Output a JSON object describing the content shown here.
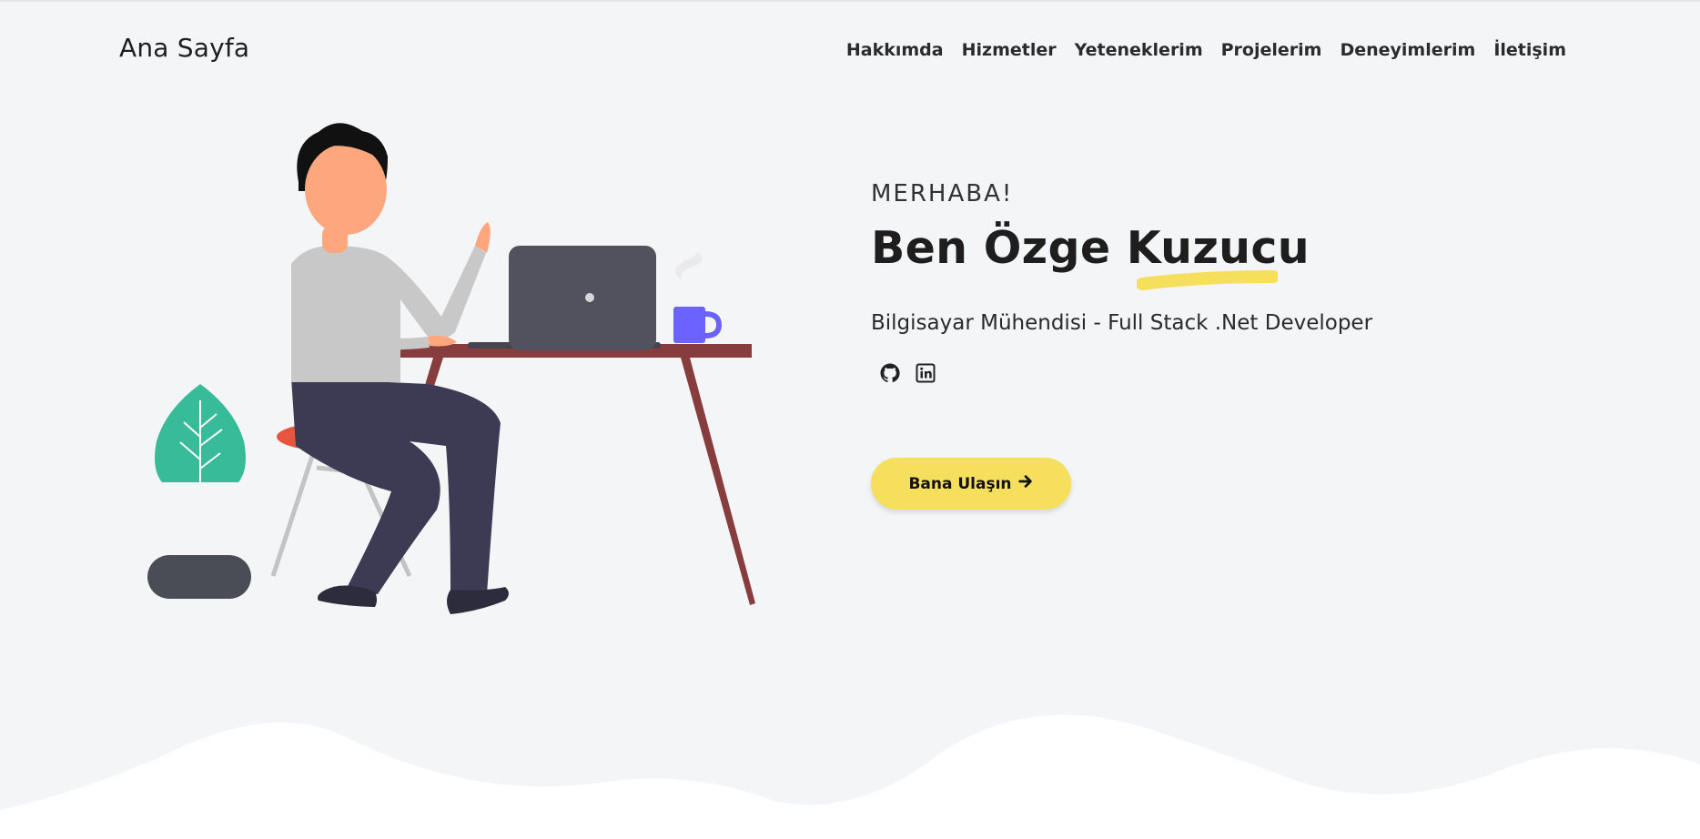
{
  "header": {
    "brand": "Ana Sayfa",
    "nav": [
      "Hakkımda",
      "Hizmetler",
      "Yeteneklerim",
      "Projelerim",
      "Deneyimlerim",
      "İletişim"
    ]
  },
  "hero": {
    "greeting": "MERHABA!",
    "name": "Ben Özge Kuzucu",
    "subtitle": "Bilgisayar Mühendisi - Full Stack .Net Developer",
    "cta_label": "Bana Ulaşın",
    "cta_icon": "arrow-right-icon"
  },
  "socials": [
    {
      "icon": "github-icon"
    },
    {
      "icon": "linkedin-icon"
    }
  ],
  "colors": {
    "background": "#f4f5f7",
    "accent_yellow": "#f7df5e",
    "text_dark": "#1e1e1e",
    "wave": "#ffffff"
  }
}
